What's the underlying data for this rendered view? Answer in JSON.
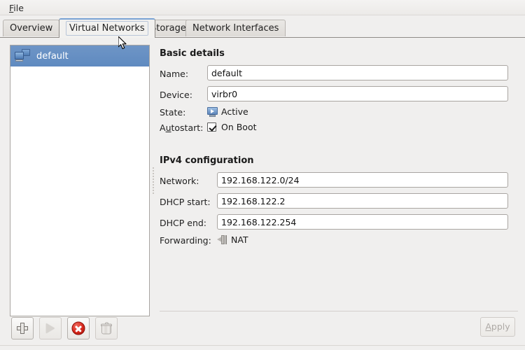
{
  "window": {
    "menubar": {
      "items": [
        {
          "label": "File",
          "mnemonic": "F"
        }
      ]
    },
    "tabs": [
      {
        "id": "overview",
        "label": "Overview",
        "active": false
      },
      {
        "id": "virtual-networks",
        "label": "Virtual Networks",
        "active": true
      },
      {
        "id": "storage",
        "label": "Storage",
        "active": false
      },
      {
        "id": "network-interfaces",
        "label": "Network Interfaces",
        "active": false
      }
    ]
  },
  "network_list": {
    "items": [
      {
        "name": "default",
        "icon": "network-icon",
        "selected": true
      }
    ]
  },
  "list_toolbar": {
    "buttons": [
      {
        "name": "add-network-button",
        "icon": "plus-icon",
        "enabled": true
      },
      {
        "name": "start-network-button",
        "icon": "play-icon",
        "enabled": false
      },
      {
        "name": "stop-network-button",
        "icon": "stop-icon",
        "enabled": true
      },
      {
        "name": "delete-network-button",
        "icon": "trash-icon",
        "enabled": false
      }
    ]
  },
  "basic_details": {
    "title": "Basic details",
    "name_label": "Name:",
    "name_value": "default",
    "device_label": "Device:",
    "device_value": "virbr0",
    "state_label": "State:",
    "state_value": "Active",
    "state_icon": "active-monitor-icon",
    "autostart_label": "Autostart:",
    "autostart_mnemonic": "u",
    "autostart_checkbox_label": "On Boot",
    "autostart_checked": true
  },
  "ipv4_configuration": {
    "title": "IPv4 configuration",
    "network_label": "Network:",
    "network_value": "192.168.122.0/24",
    "dhcp_start_label": "DHCP start:",
    "dhcp_start_value": "192.168.122.2",
    "dhcp_end_label": "DHCP end:",
    "dhcp_end_value": "192.168.122.254",
    "forwarding_label": "Forwarding:",
    "forwarding_value": "NAT",
    "forwarding_icon": "forward-nat-icon"
  },
  "footer": {
    "apply_label": "Apply",
    "apply_mnemonic": "A",
    "apply_enabled": false
  },
  "colors": {
    "selection_blue": "#5f8ac0",
    "active_tab_accent": "#7aa3d4",
    "stop_red": "#d8281c",
    "window_bg": "#f0efee",
    "field_bg": "#ffffff"
  }
}
